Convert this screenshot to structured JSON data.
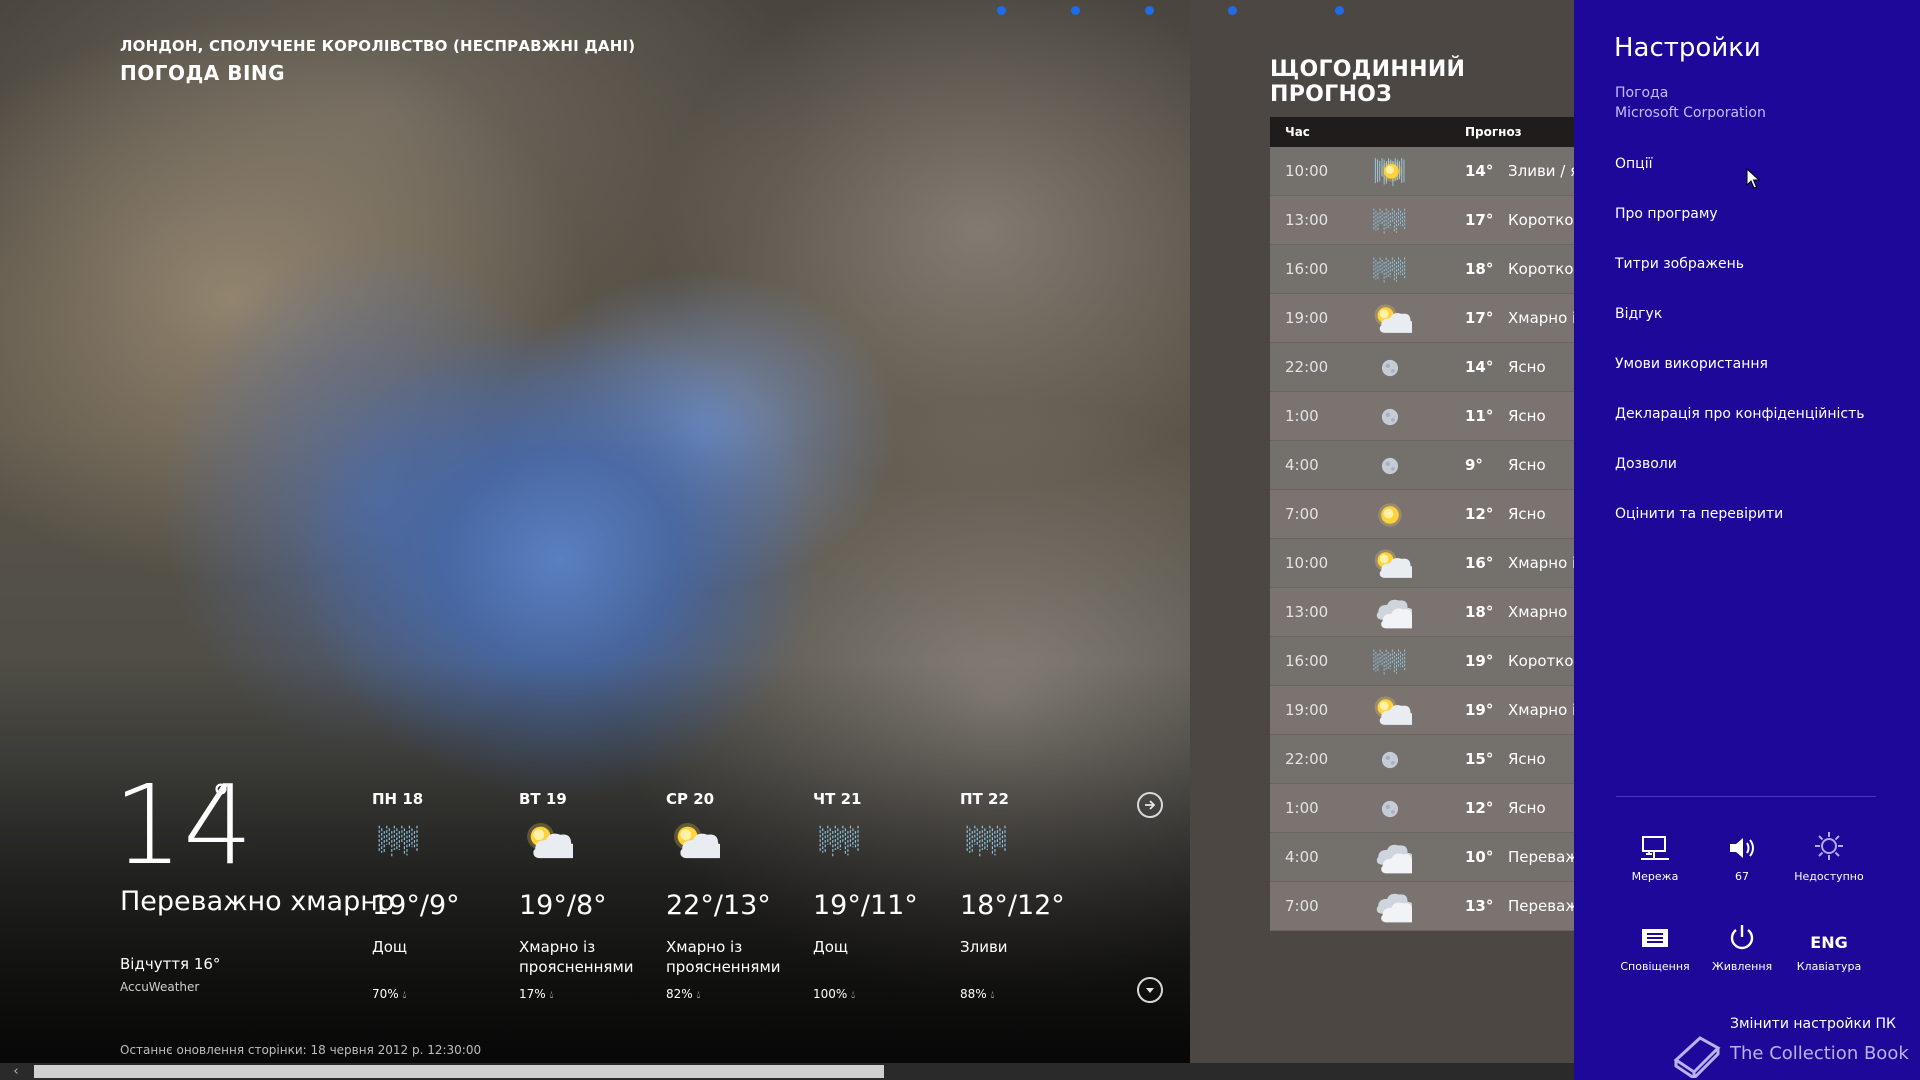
{
  "header": {
    "location": "ЛОНДОН, СПОЛУЧЕНЕ КОРОЛІВСТВО (НЕСПРАВЖНІ ДАНІ)",
    "app_title": "ПОГОДА BING"
  },
  "current": {
    "temperature": "14",
    "degree": "°",
    "condition": "Переважно хмарно",
    "feels_like": "Відчуття 16°",
    "provider": "AccuWeather",
    "last_updated": "Останнє оновлення сторінки: 18 червня 2012 р. 12:30:00"
  },
  "daily": [
    {
      "name": "ПН 18",
      "icon": "rain-icon",
      "hilo": "19°/9°",
      "desc": "Дощ",
      "precip": "70%"
    },
    {
      "name": "ВТ 19",
      "icon": "partly-cloudy-icon",
      "hilo": "19°/8°",
      "desc": "Хмарно із проясненнями",
      "precip": "17%"
    },
    {
      "name": "СР 20",
      "icon": "partly-cloudy-icon",
      "hilo": "22°/13°",
      "desc": "Хмарно із проясненнями",
      "precip": "82%"
    },
    {
      "name": "ЧТ 21",
      "icon": "rain-icon",
      "hilo": "19°/11°",
      "desc": "Дощ",
      "precip": "100%"
    },
    {
      "name": "ПТ 22",
      "icon": "rain-icon",
      "hilo": "18°/12°",
      "desc": "Зливи",
      "precip": "88%"
    }
  ],
  "hourly": {
    "title": "ЩОГОДИННИЙ ПРОГНОЗ",
    "col_time": "Час",
    "col_forecast": "Прогноз",
    "rows": [
      {
        "time": "10:00",
        "icon": "sun-shower-icon",
        "temp": "14°",
        "cond": "Зливи / ясно"
      },
      {
        "time": "13:00",
        "icon": "rain-icon",
        "temp": "17°",
        "cond": "Короткочасні зливи"
      },
      {
        "time": "16:00",
        "icon": "rain-icon",
        "temp": "18°",
        "cond": "Короткочасні зливи"
      },
      {
        "time": "19:00",
        "icon": "partly-cloudy-icon",
        "temp": "17°",
        "cond": "Хмарно із проясненнями"
      },
      {
        "time": "22:00",
        "icon": "moon-icon",
        "temp": "14°",
        "cond": "Ясно"
      },
      {
        "time": "1:00",
        "icon": "moon-icon",
        "temp": "11°",
        "cond": "Ясно"
      },
      {
        "time": "4:00",
        "icon": "moon-icon",
        "temp": "9°",
        "cond": "Ясно"
      },
      {
        "time": "7:00",
        "icon": "sun-icon",
        "temp": "12°",
        "cond": "Ясно"
      },
      {
        "time": "10:00",
        "icon": "partly-cloudy-icon",
        "temp": "16°",
        "cond": "Хмарно із проясненнями"
      },
      {
        "time": "13:00",
        "icon": "cloudy-icon",
        "temp": "18°",
        "cond": "Хмарно"
      },
      {
        "time": "16:00",
        "icon": "rain-icon",
        "temp": "19°",
        "cond": "Короткочасні зливи"
      },
      {
        "time": "19:00",
        "icon": "partly-cloudy-icon",
        "temp": "19°",
        "cond": "Хмарно із проясненнями"
      },
      {
        "time": "22:00",
        "icon": "moon-icon",
        "temp": "15°",
        "cond": "Ясно"
      },
      {
        "time": "1:00",
        "icon": "moon-icon",
        "temp": "12°",
        "cond": "Ясно"
      },
      {
        "time": "4:00",
        "icon": "cloudy-icon",
        "temp": "10°",
        "cond": "Переважно хмарно"
      },
      {
        "time": "7:00",
        "icon": "cloudy-icon",
        "temp": "13°",
        "cond": "Переважно хмарно"
      }
    ]
  },
  "settings": {
    "title": "Настройки",
    "app_name": "Погода",
    "publisher": "Microsoft Corporation",
    "items": [
      "Опції",
      "Про програму",
      "Титри зображень",
      "Відгук",
      "Умови використання",
      "Декларація про конфіденційність",
      "Дозволи",
      "Оцінити та перевірити"
    ],
    "quick": [
      {
        "label": "Мережа",
        "icon": "network-icon"
      },
      {
        "label": "67",
        "icon": "volume-icon"
      },
      {
        "label": "Недоступно",
        "icon": "brightness-icon"
      },
      {
        "label": "Сповіщення",
        "icon": "notifications-icon"
      },
      {
        "label": "Живлення",
        "icon": "power-icon"
      },
      {
        "label": "Клавіатура",
        "icon": "keyboard-icon",
        "glyph": "ENG"
      }
    ],
    "change_pc": "Змінити настройки ПК",
    "watermark": "The Collection Book"
  },
  "colors": {
    "charm_bg": "#1d0899",
    "hourly_bg": "#4d4744",
    "accent_dot": "#1f6ce8"
  }
}
